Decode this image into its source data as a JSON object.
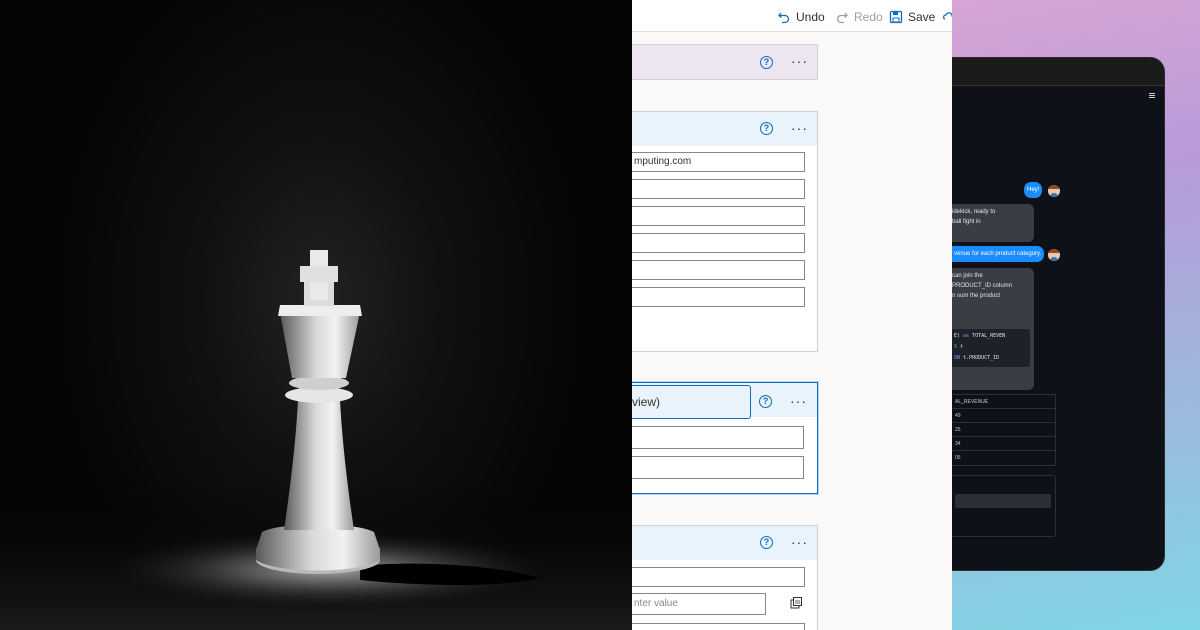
{
  "designer": {
    "commands": [
      {
        "label": "Undo",
        "icon": "undo-icon",
        "enabled": true
      },
      {
        "label": "Redo",
        "icon": "redo-icon",
        "enabled": false
      },
      {
        "label": "Save",
        "icon": "save-icon",
        "enabled": true
      }
    ],
    "sections": {
      "details": {
        "fields": [
          "mputing.com",
          "",
          "",
          "",
          "",
          ""
        ]
      },
      "preview": {
        "title": "view)",
        "fields": [
          "",
          ""
        ]
      },
      "bottom": {
        "fields": [
          "",
          "nter value"
        ]
      }
    }
  },
  "chat": {
    "messages": [
      {
        "role": "user",
        "text": "Hey!"
      },
      {
        "role": "assistant",
        "lines": [
          "idekick, ready to",
          "ball fight in"
        ]
      },
      {
        "role": "user",
        "text": "venue for each product category."
      },
      {
        "role": "assistant",
        "lines": [
          "can join the",
          "PRODUCT_ID column",
          "n sum the product"
        ]
      }
    ],
    "code_lines": [
      {
        "pre": "E) ",
        "kw": "as",
        "post": " TOTAL_REVEN"
      },
      {
        "pre": "",
        "kw": "S",
        "post": " t"
      },
      {
        "pre": "",
        "kw": "ON",
        "post": " t.PRODUCT_ID"
      }
    ],
    "table": {
      "header": "AL_REVENUE",
      "rows": [
        "49",
        "25",
        "34",
        "05"
      ]
    }
  },
  "colors": {
    "accent_blue": "#0f6cbd",
    "chat_user_bubble": "#1a8cff",
    "chat_bg": "#0e1117"
  }
}
